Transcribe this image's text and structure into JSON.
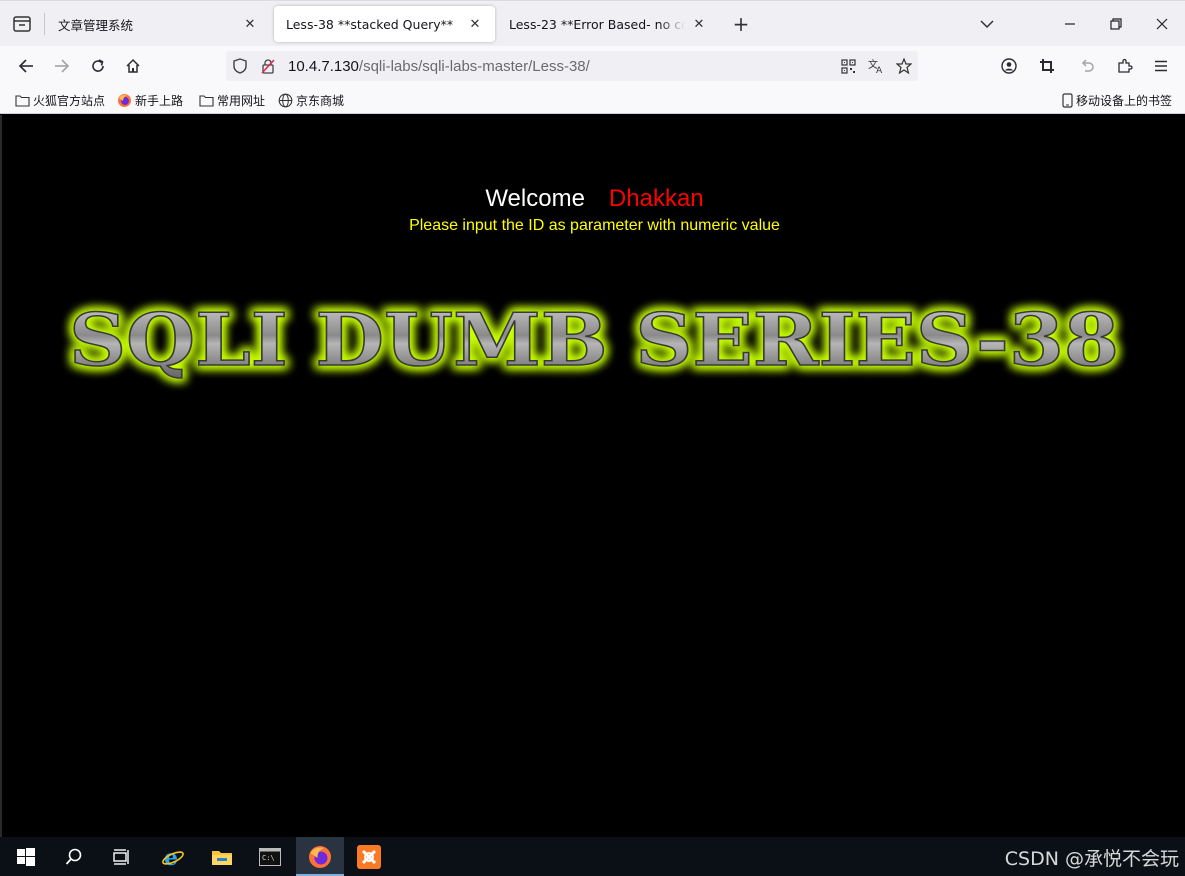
{
  "browser": {
    "tabs": [
      {
        "title": "文章管理系统",
        "active": false
      },
      {
        "title": "Less-38 **stacked Query**",
        "active": true
      },
      {
        "title": "Less-23 **Error Based- no comments**",
        "active": false
      }
    ],
    "url": {
      "host": "10.4.7.130",
      "path": "/sqli-labs/sqli-labs-master/Less-38/"
    },
    "bookmarks": [
      {
        "label": "火狐官方站点",
        "icon": "folder-icon"
      },
      {
        "label": "新手上路",
        "icon": "firefox-icon"
      },
      {
        "label": "常用网址",
        "icon": "folder-icon"
      },
      {
        "label": "京东商城",
        "icon": "globe-icon"
      }
    ],
    "mobile_bookmarks": "移动设备上的书签"
  },
  "page": {
    "welcome": "Welcome",
    "user": "Dhakkan",
    "instruction": "Please input the ID as parameter with numeric value",
    "banner_text": "SQLI DUMB SERIES-38",
    "colors": {
      "background": "#000000",
      "welcome": "#ffffff",
      "user": "#ff0000",
      "instruction": "#ffff00",
      "banner_glow": "#c8ff00"
    }
  },
  "taskbar": {
    "items": [
      "start-icon",
      "search-icon",
      "task-view-icon",
      "ie-icon",
      "file-explorer-icon",
      "terminal-icon",
      "firefox-icon",
      "xampp-icon"
    ]
  },
  "watermark": "CSDN @承悦不会玩"
}
